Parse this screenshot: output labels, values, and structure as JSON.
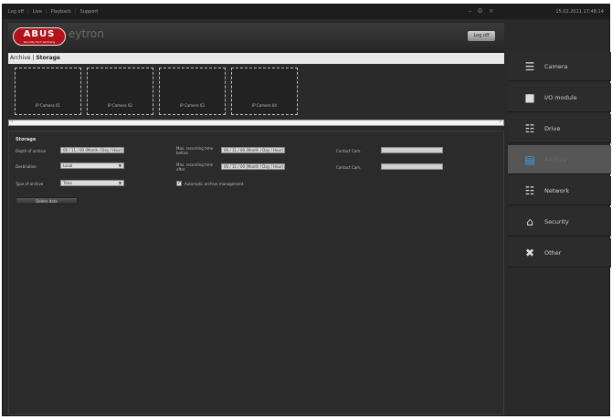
{
  "topbar": {
    "menu": [
      "Log off",
      "Live",
      "Playback",
      "Support"
    ],
    "datetime": "15.02.2011 17:48:14"
  },
  "header": {
    "logo_text": "ABUS",
    "logo_subtext": "Security Tech Germany",
    "brand": "eytron",
    "logout_label": "Log off"
  },
  "breadcrumb": {
    "section": "Archive",
    "page": "Storage"
  },
  "cameras": [
    {
      "label": "IP Camera 01"
    },
    {
      "label": "IP Camera 02"
    },
    {
      "label": "IP Camera 03"
    },
    {
      "label": "IP Camera 04"
    }
  ],
  "storage": {
    "title": "Storage",
    "fields": {
      "depth_label": "Depth of archive",
      "depth_value": "00 / 11 / 00 (Month / Day / Hour)",
      "destination_label": "Destination",
      "destination_value": "Local",
      "type_label": "Type of archive",
      "type_value": "Time",
      "max_before_label": "Max. recording time before",
      "max_before_value": "00 / 11 / 00 (Month / Day / Hour)",
      "max_after_label": "Max. recording time after",
      "max_after_value": "00 / 11 / 00 (Month / Day / Hour)",
      "contact1_label": "Contact Cam.",
      "contact1_value": "",
      "contact2_label": "Contact Cam.",
      "contact2_value": "",
      "auto_label": "Automatic archive management",
      "auto_checked": true
    },
    "delete_label": "Delete data"
  },
  "sidebar": {
    "items": [
      {
        "label": "Camera",
        "icon": "camera-icon",
        "glyph": "☰",
        "active": false
      },
      {
        "label": "I/O module",
        "icon": "io-module-icon",
        "glyph": "■",
        "active": false
      },
      {
        "label": "Drive",
        "icon": "drive-icon",
        "glyph": "☷",
        "active": false
      },
      {
        "label": "Archive",
        "icon": "archive-icon",
        "glyph": "▤",
        "active": true
      },
      {
        "label": "Network",
        "icon": "network-icon",
        "glyph": "☷",
        "active": false
      },
      {
        "label": "Security",
        "icon": "lock-icon",
        "glyph": "⌂",
        "active": false
      },
      {
        "label": "Other",
        "icon": "tools-icon",
        "glyph": "✖",
        "active": false
      }
    ]
  },
  "colors": {
    "accent": "#3e9fe0",
    "logo": "#b3121a",
    "background": "#2a2a2a"
  }
}
